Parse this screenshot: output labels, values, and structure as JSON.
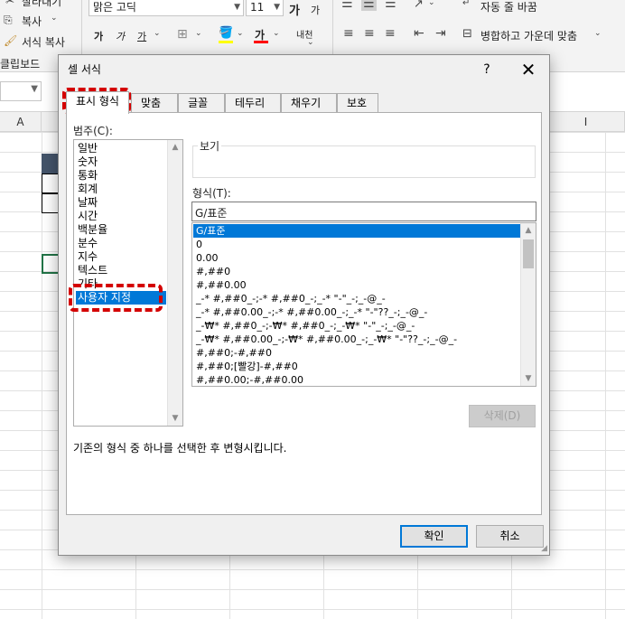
{
  "ribbon": {
    "clipboard": {
      "cut_label": "잘라내기",
      "copy_label": "복사",
      "format_painter_label": "서식 복사",
      "group_label": "클립보드"
    },
    "font": {
      "font_name": "맑은 고딕",
      "font_size": "11",
      "grow_font": "가",
      "shrink_font": "가",
      "bold": "가",
      "italic": "가",
      "underline": "가",
      "font_color_glyph": "가",
      "phonetic": "내천"
    },
    "alignment": {
      "wrap_text_label": "자동 줄 바꿈",
      "merge_center_label": "병합하고 가운데 맞춤"
    }
  },
  "sheet": {
    "columns": [
      "A",
      "I"
    ]
  },
  "dialog": {
    "title": "셀 서식",
    "help": "?",
    "close": "✕",
    "tabs": [
      "표시 형식",
      "맞춤",
      "글꼴",
      "테두리",
      "채우기",
      "보호"
    ],
    "category_label": "범주(C):",
    "categories": [
      "일반",
      "숫자",
      "통화",
      "회계",
      "날짜",
      "시간",
      "백분율",
      "분수",
      "지수",
      "텍스트",
      "기타",
      "사용자 지정"
    ],
    "selected_category": "사용자 지정",
    "sample_label": "보기",
    "type_label": "형식(T):",
    "type_value": "G/표준",
    "formats": [
      "G/표준",
      "0",
      "0.00",
      "#,##0",
      "#,##0.00",
      "_-* #,##0_-;-* #,##0_-;_-* \"-\"_-;_-@_-",
      "_-* #,##0.00_-;-* #,##0.00_-;_-* \"-\"??_-;_-@_-",
      "_-₩* #,##0_-;-₩* #,##0_-;_-₩* \"-\"_-;_-@_-",
      "_-₩* #,##0.00_-;-₩* #,##0.00_-;_-₩* \"-\"??_-;_-@_-",
      "#,##0;-#,##0",
      "#,##0;[빨강]-#,##0",
      "#,##0.00;-#,##0.00"
    ],
    "delete_label": "삭제(D)",
    "description": "기존의 형식 중 하나를 선택한 후 변형시킵니다.",
    "ok_label": "확인",
    "cancel_label": "취소"
  },
  "colors": {
    "selection": "#0078d7",
    "highlight_dash": "#d40000",
    "header_fill": "#44546a",
    "excel_green": "#217346"
  }
}
